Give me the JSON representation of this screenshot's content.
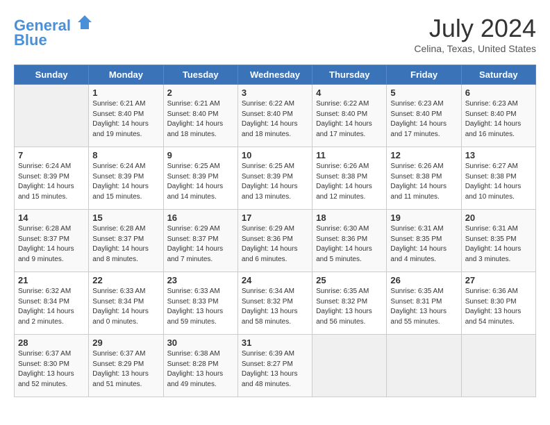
{
  "header": {
    "logo_line1": "General",
    "logo_line2": "Blue",
    "month_title": "July 2024",
    "location": "Celina, Texas, United States"
  },
  "weekdays": [
    "Sunday",
    "Monday",
    "Tuesday",
    "Wednesday",
    "Thursday",
    "Friday",
    "Saturday"
  ],
  "weeks": [
    [
      {
        "day": "",
        "sunrise": "",
        "sunset": "",
        "daylight": ""
      },
      {
        "day": "1",
        "sunrise": "Sunrise: 6:21 AM",
        "sunset": "Sunset: 8:40 PM",
        "daylight": "Daylight: 14 hours and 19 minutes."
      },
      {
        "day": "2",
        "sunrise": "Sunrise: 6:21 AM",
        "sunset": "Sunset: 8:40 PM",
        "daylight": "Daylight: 14 hours and 18 minutes."
      },
      {
        "day": "3",
        "sunrise": "Sunrise: 6:22 AM",
        "sunset": "Sunset: 8:40 PM",
        "daylight": "Daylight: 14 hours and 18 minutes."
      },
      {
        "day": "4",
        "sunrise": "Sunrise: 6:22 AM",
        "sunset": "Sunset: 8:40 PM",
        "daylight": "Daylight: 14 hours and 17 minutes."
      },
      {
        "day": "5",
        "sunrise": "Sunrise: 6:23 AM",
        "sunset": "Sunset: 8:40 PM",
        "daylight": "Daylight: 14 hours and 17 minutes."
      },
      {
        "day": "6",
        "sunrise": "Sunrise: 6:23 AM",
        "sunset": "Sunset: 8:40 PM",
        "daylight": "Daylight: 14 hours and 16 minutes."
      }
    ],
    [
      {
        "day": "7",
        "sunrise": "Sunrise: 6:24 AM",
        "sunset": "Sunset: 8:39 PM",
        "daylight": "Daylight: 14 hours and 15 minutes."
      },
      {
        "day": "8",
        "sunrise": "Sunrise: 6:24 AM",
        "sunset": "Sunset: 8:39 PM",
        "daylight": "Daylight: 14 hours and 15 minutes."
      },
      {
        "day": "9",
        "sunrise": "Sunrise: 6:25 AM",
        "sunset": "Sunset: 8:39 PM",
        "daylight": "Daylight: 14 hours and 14 minutes."
      },
      {
        "day": "10",
        "sunrise": "Sunrise: 6:25 AM",
        "sunset": "Sunset: 8:39 PM",
        "daylight": "Daylight: 14 hours and 13 minutes."
      },
      {
        "day": "11",
        "sunrise": "Sunrise: 6:26 AM",
        "sunset": "Sunset: 8:38 PM",
        "daylight": "Daylight: 14 hours and 12 minutes."
      },
      {
        "day": "12",
        "sunrise": "Sunrise: 6:26 AM",
        "sunset": "Sunset: 8:38 PM",
        "daylight": "Daylight: 14 hours and 11 minutes."
      },
      {
        "day": "13",
        "sunrise": "Sunrise: 6:27 AM",
        "sunset": "Sunset: 8:38 PM",
        "daylight": "Daylight: 14 hours and 10 minutes."
      }
    ],
    [
      {
        "day": "14",
        "sunrise": "Sunrise: 6:28 AM",
        "sunset": "Sunset: 8:37 PM",
        "daylight": "Daylight: 14 hours and 9 minutes."
      },
      {
        "day": "15",
        "sunrise": "Sunrise: 6:28 AM",
        "sunset": "Sunset: 8:37 PM",
        "daylight": "Daylight: 14 hours and 8 minutes."
      },
      {
        "day": "16",
        "sunrise": "Sunrise: 6:29 AM",
        "sunset": "Sunset: 8:37 PM",
        "daylight": "Daylight: 14 hours and 7 minutes."
      },
      {
        "day": "17",
        "sunrise": "Sunrise: 6:29 AM",
        "sunset": "Sunset: 8:36 PM",
        "daylight": "Daylight: 14 hours and 6 minutes."
      },
      {
        "day": "18",
        "sunrise": "Sunrise: 6:30 AM",
        "sunset": "Sunset: 8:36 PM",
        "daylight": "Daylight: 14 hours and 5 minutes."
      },
      {
        "day": "19",
        "sunrise": "Sunrise: 6:31 AM",
        "sunset": "Sunset: 8:35 PM",
        "daylight": "Daylight: 14 hours and 4 minutes."
      },
      {
        "day": "20",
        "sunrise": "Sunrise: 6:31 AM",
        "sunset": "Sunset: 8:35 PM",
        "daylight": "Daylight: 14 hours and 3 minutes."
      }
    ],
    [
      {
        "day": "21",
        "sunrise": "Sunrise: 6:32 AM",
        "sunset": "Sunset: 8:34 PM",
        "daylight": "Daylight: 14 hours and 2 minutes."
      },
      {
        "day": "22",
        "sunrise": "Sunrise: 6:33 AM",
        "sunset": "Sunset: 8:34 PM",
        "daylight": "Daylight: 14 hours and 0 minutes."
      },
      {
        "day": "23",
        "sunrise": "Sunrise: 6:33 AM",
        "sunset": "Sunset: 8:33 PM",
        "daylight": "Daylight: 13 hours and 59 minutes."
      },
      {
        "day": "24",
        "sunrise": "Sunrise: 6:34 AM",
        "sunset": "Sunset: 8:32 PM",
        "daylight": "Daylight: 13 hours and 58 minutes."
      },
      {
        "day": "25",
        "sunrise": "Sunrise: 6:35 AM",
        "sunset": "Sunset: 8:32 PM",
        "daylight": "Daylight: 13 hours and 56 minutes."
      },
      {
        "day": "26",
        "sunrise": "Sunrise: 6:35 AM",
        "sunset": "Sunset: 8:31 PM",
        "daylight": "Daylight: 13 hours and 55 minutes."
      },
      {
        "day": "27",
        "sunrise": "Sunrise: 6:36 AM",
        "sunset": "Sunset: 8:30 PM",
        "daylight": "Daylight: 13 hours and 54 minutes."
      }
    ],
    [
      {
        "day": "28",
        "sunrise": "Sunrise: 6:37 AM",
        "sunset": "Sunset: 8:30 PM",
        "daylight": "Daylight: 13 hours and 52 minutes."
      },
      {
        "day": "29",
        "sunrise": "Sunrise: 6:37 AM",
        "sunset": "Sunset: 8:29 PM",
        "daylight": "Daylight: 13 hours and 51 minutes."
      },
      {
        "day": "30",
        "sunrise": "Sunrise: 6:38 AM",
        "sunset": "Sunset: 8:28 PM",
        "daylight": "Daylight: 13 hours and 49 minutes."
      },
      {
        "day": "31",
        "sunrise": "Sunrise: 6:39 AM",
        "sunset": "Sunset: 8:27 PM",
        "daylight": "Daylight: 13 hours and 48 minutes."
      },
      {
        "day": "",
        "sunrise": "",
        "sunset": "",
        "daylight": ""
      },
      {
        "day": "",
        "sunrise": "",
        "sunset": "",
        "daylight": ""
      },
      {
        "day": "",
        "sunrise": "",
        "sunset": "",
        "daylight": ""
      }
    ]
  ]
}
